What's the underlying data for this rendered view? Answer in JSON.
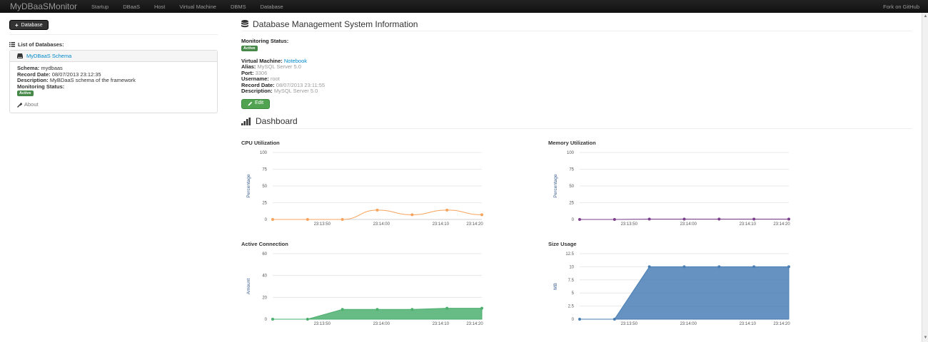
{
  "navbar": {
    "brand": "MyDBaaSMonitor",
    "items": [
      "Startup",
      "DBaaS",
      "Host",
      "Virtual Machine",
      "DBMS",
      "Database"
    ],
    "fork": "Fork on GitHub"
  },
  "sidebar": {
    "add_button": "Database",
    "list_title": "List of Databases:",
    "db": {
      "name": "MyDBaaS Schema",
      "schema_label": "Schema:",
      "schema_value": "mydbaas",
      "record_label": "Record Date:",
      "record_value": "08/07/2013 23:12:35",
      "desc_label": "Description:",
      "desc_value": "MyBDaaS schema of the framework",
      "monitoring_label": "Monitoring Status:",
      "status": "Active",
      "about": "About"
    }
  },
  "dbms": {
    "title": "Database Management System Information",
    "monitoring_label": "Monitoring Status:",
    "status": "Active",
    "vm_label": "Virtual Machine:",
    "vm_value": "Notebook",
    "alias_label": "Alias:",
    "alias_value": "MySQL Server 5.0",
    "port_label": "Port:",
    "port_value": "3306",
    "user_label": "Username:",
    "user_value": "root",
    "record_label": "Record Date:",
    "record_value": "08/07/2013 23:11:55",
    "desc_label": "Description:",
    "desc_value": "MySQL Server 5.0",
    "edit_button": "Edit"
  },
  "dashboard": {
    "title": "Dashboard"
  },
  "colors": {
    "cpu": "#f7a35c",
    "memory": "#7b3f8c",
    "conn": "#4caf6e",
    "size": "#4a7fb5"
  },
  "chart_data": [
    {
      "type": "line",
      "title": "CPU Utilization",
      "ylabel": "Percentage",
      "ylim": [
        0,
        100
      ],
      "yticks": [
        "0",
        "25",
        "50",
        "75",
        "100"
      ],
      "xticks": [
        "23:13:50",
        "23:14:00",
        "23:14:10",
        "23:14:20"
      ],
      "series": [
        {
          "values": [
            0,
            0,
            0,
            14,
            7,
            14,
            7
          ]
        }
      ]
    },
    {
      "type": "line",
      "title": "Memory Utilization",
      "ylabel": "Percentage",
      "ylim": [
        0,
        100
      ],
      "yticks": [
        "0",
        "25",
        "50",
        "75",
        "100"
      ],
      "xticks": [
        "23:13:50",
        "23:14:00",
        "23:14:10",
        "23:14:20"
      ],
      "series": [
        {
          "values": [
            0,
            0,
            0.5,
            0.5,
            0.5,
            0.5,
            0.5
          ]
        }
      ]
    },
    {
      "type": "area",
      "title": "Active Connection",
      "ylabel": "Amount",
      "ylim": [
        0,
        60
      ],
      "yticks": [
        "0",
        "20",
        "40",
        "60"
      ],
      "xticks": [
        "23:13:50",
        "23:14:00",
        "23:14:10",
        "23:14:20"
      ],
      "series": [
        {
          "values": [
            0,
            0,
            9,
            9,
            9,
            10,
            10
          ]
        }
      ]
    },
    {
      "type": "area",
      "title": "Size Usage",
      "ylabel": "MB",
      "ylim": [
        0,
        12.5
      ],
      "yticks": [
        "0",
        "2.5",
        "5",
        "7.5",
        "10",
        "12.5"
      ],
      "xticks": [
        "23:13:50",
        "23:14:00",
        "23:14:10",
        "23:14:20"
      ],
      "series": [
        {
          "values": [
            0,
            0,
            10,
            10,
            10,
            10,
            10
          ]
        }
      ]
    }
  ]
}
